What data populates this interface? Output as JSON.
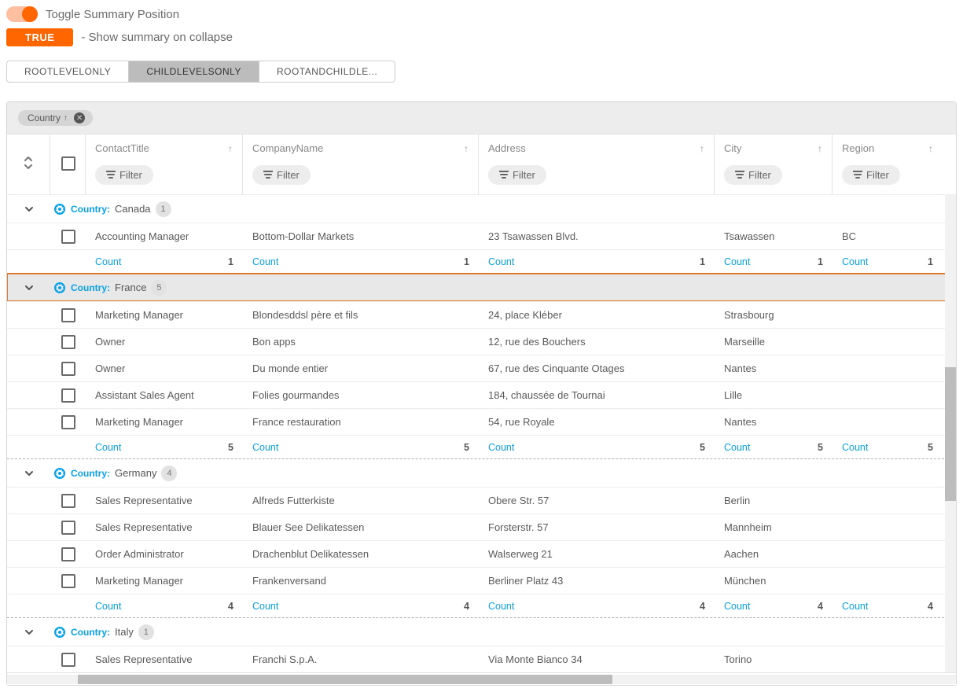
{
  "top": {
    "toggleLabel": "Toggle Summary Position",
    "trueBadge": "TRUE",
    "trueText": "- Show summary on collapse"
  },
  "tabs": {
    "items": [
      {
        "label": "ROOTLEVELONLY",
        "active": false
      },
      {
        "label": "CHILDLEVELSONLY",
        "active": true
      },
      {
        "label": "ROOTANDCHILDLE...",
        "active": false
      }
    ]
  },
  "groupBy": {
    "chip": {
      "field": "Country"
    }
  },
  "columns": {
    "contact": "ContactTitle",
    "company": "CompanyName",
    "address": "Address",
    "city": "City",
    "region": "Region",
    "filterLabel": "Filter"
  },
  "summaryLabel": "Count",
  "groups": [
    {
      "name": "Canada",
      "count": "1",
      "active": false,
      "rows": [
        {
          "contact": "Accounting Manager",
          "company": "Bottom-Dollar Markets",
          "address": "23 Tsawassen Blvd.",
          "city": "Tsawassen",
          "region": "BC"
        }
      ],
      "summary": "1"
    },
    {
      "name": "France",
      "count": "5",
      "active": true,
      "rows": [
        {
          "contact": "Marketing Manager",
          "company": "Blondesddsl père et fils",
          "address": "24, place Kléber",
          "city": "Strasbourg",
          "region": ""
        },
        {
          "contact": "Owner",
          "company": "Bon apps",
          "address": "12, rue des Bouchers",
          "city": "Marseille",
          "region": ""
        },
        {
          "contact": "Owner",
          "company": "Du monde entier",
          "address": "67, rue des Cinquante Otages",
          "city": "Nantes",
          "region": ""
        },
        {
          "contact": "Assistant Sales Agent",
          "company": "Folies gourmandes",
          "address": "184, chaussée de Tournai",
          "city": "Lille",
          "region": ""
        },
        {
          "contact": "Marketing Manager",
          "company": "France restauration",
          "address": "54, rue Royale",
          "city": "Nantes",
          "region": ""
        }
      ],
      "summary": "5"
    },
    {
      "name": "Germany",
      "count": "4",
      "active": false,
      "rows": [
        {
          "contact": "Sales Representative",
          "company": "Alfreds Futterkiste",
          "address": "Obere Str. 57",
          "city": "Berlin",
          "region": ""
        },
        {
          "contact": "Sales Representative",
          "company": "Blauer See Delikatessen",
          "address": "Forsterstr. 57",
          "city": "Mannheim",
          "region": ""
        },
        {
          "contact": "Order Administrator",
          "company": "Drachenblut Delikatessen",
          "address": "Walserweg 21",
          "city": "Aachen",
          "region": ""
        },
        {
          "contact": "Marketing Manager",
          "company": "Frankenversand",
          "address": "Berliner Platz 43",
          "city": "München",
          "region": ""
        }
      ],
      "summary": "4"
    },
    {
      "name": "Italy",
      "count": "1",
      "active": false,
      "rows": [
        {
          "contact": "Sales Representative",
          "company": "Franchi S.p.A.",
          "address": "Via Monte Bianco 34",
          "city": "Torino",
          "region": ""
        }
      ],
      "summary": null
    }
  ]
}
